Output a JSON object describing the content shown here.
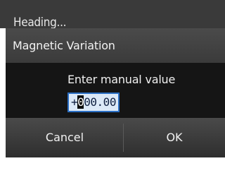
{
  "background": {
    "title": "Heading..."
  },
  "dialog": {
    "title": "Magnetic Variation",
    "prompt": "Enter manual value",
    "value": {
      "prefix": "+",
      "cursor_char": "0",
      "suffix": "00.00"
    },
    "buttons": {
      "cancel": "Cancel",
      "ok": "OK"
    }
  },
  "colors": {
    "field_fill": "#dce9f8",
    "field_border": "#2b6fc4",
    "dialog_bg": "#151515"
  }
}
